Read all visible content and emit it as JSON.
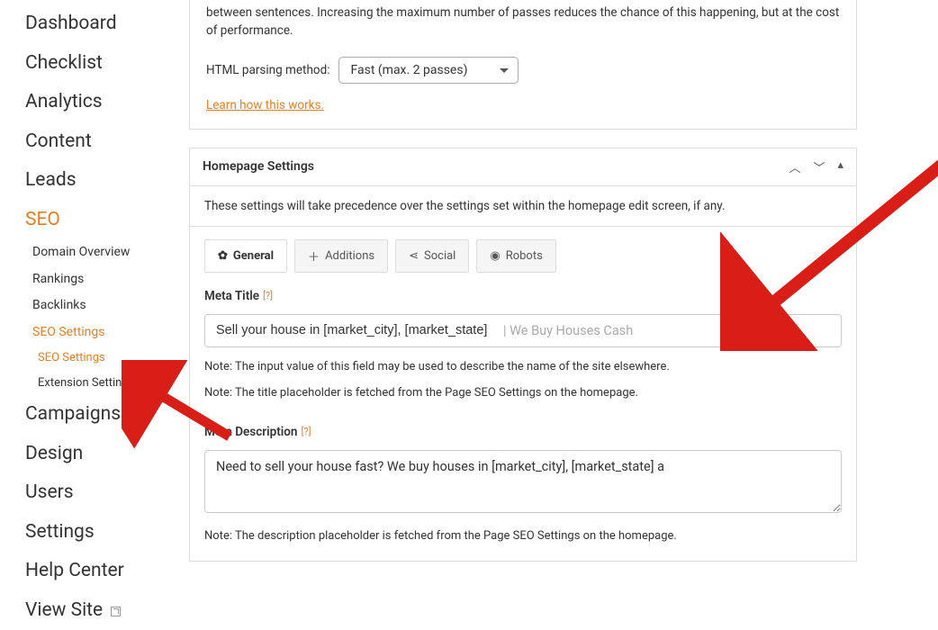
{
  "sidebar": {
    "items": [
      {
        "label": "Dashboard"
      },
      {
        "label": "Checklist"
      },
      {
        "label": "Analytics"
      },
      {
        "label": "Content"
      },
      {
        "label": "Leads"
      },
      {
        "label": "SEO",
        "active": true
      },
      {
        "label": "Campaigns"
      },
      {
        "label": "Design"
      },
      {
        "label": "Users"
      },
      {
        "label": "Settings"
      },
      {
        "label": "Help Center"
      },
      {
        "label": "View Site"
      }
    ],
    "seo_sub": [
      {
        "label": "Domain Overview"
      },
      {
        "label": "Rankings"
      },
      {
        "label": "Backlinks"
      },
      {
        "label": "SEO Settings",
        "active": true
      }
    ],
    "seo_settings_sub": [
      {
        "label": "SEO Settings",
        "active": true
      },
      {
        "label": "Extension Settings"
      }
    ]
  },
  "top_section": {
    "desc": "between sentences. Increasing the maximum number of passes reduces the chance of this happening, but at the cost of performance.",
    "parsing_label": "HTML parsing method:",
    "parsing_value": "Fast (max. 2 passes)",
    "learn_link": "Learn how this works."
  },
  "homepage": {
    "panel_title": "Homepage Settings",
    "precedence_note": "These settings will take precedence over the settings set within the homepage edit screen, if any.",
    "tabs": [
      {
        "label": "General",
        "icon": "gear"
      },
      {
        "label": "Additions",
        "icon": "plus"
      },
      {
        "label": "Social",
        "icon": "share"
      },
      {
        "label": "Robots",
        "icon": "eye"
      }
    ],
    "meta_title": {
      "label": "Meta Title",
      "help": "[?]",
      "value": "Sell your house in [market_city], [market_state]",
      "suffix": "| We Buy Houses Cash",
      "note1": "Note: The input value of this field may be used to describe the name of the site elsewhere.",
      "note2": "Note: The title placeholder is fetched from the Page SEO Settings on the homepage."
    },
    "meta_description": {
      "label": "Meta Description",
      "help": "[?]",
      "value": "Need to sell your house fast? We buy houses in [market_city], [market_state] a",
      "note": "Note: The description placeholder is fetched from the Page SEO Settings on the homepage."
    }
  }
}
